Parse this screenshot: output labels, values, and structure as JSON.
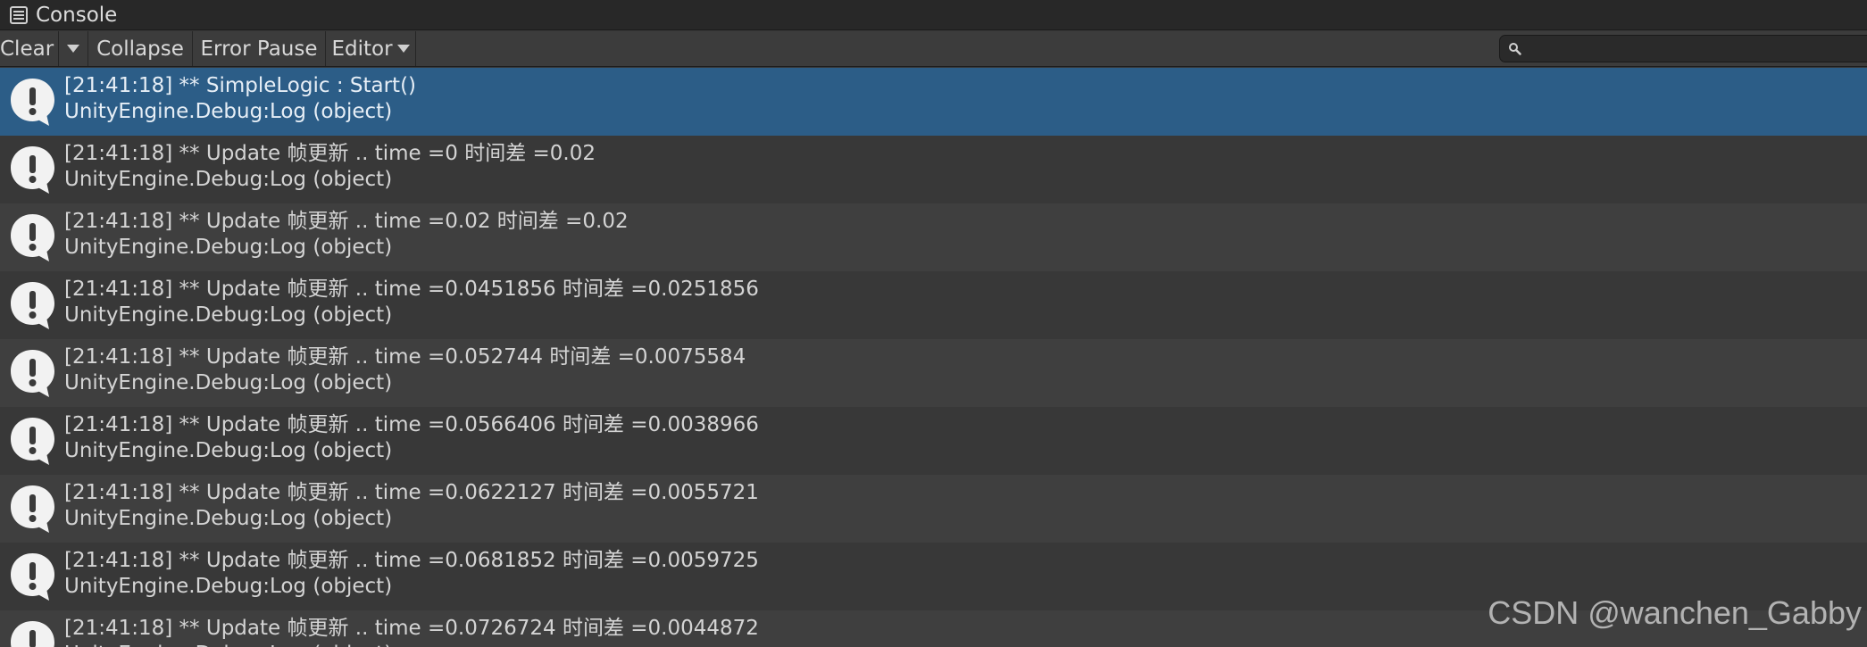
{
  "window": {
    "title": "Console",
    "tab_icon": "console-list-icon"
  },
  "toolbar": {
    "clear_label": "Clear",
    "clear_dropdown_icon": "chevron-down-icon",
    "collapse_label": "Collapse",
    "error_pause_label": "Error Pause",
    "editor_label": "Editor",
    "editor_dropdown_icon": "chevron-down-icon"
  },
  "search": {
    "icon": "search-icon",
    "value": "",
    "placeholder": ""
  },
  "log_entries": [
    {
      "message": "[21:41:18] ** SimpleLogic : Start()",
      "stack": "UnityEngine.Debug:Log (object)",
      "selected": true
    },
    {
      "message": "[21:41:18] ** Update 帧更新 .. time =0 时间差 =0.02",
      "stack": "UnityEngine.Debug:Log (object)"
    },
    {
      "message": "[21:41:18] ** Update 帧更新 .. time =0.02 时间差 =0.02",
      "stack": "UnityEngine.Debug:Log (object)"
    },
    {
      "message": "[21:41:18] ** Update 帧更新 .. time =0.0451856 时间差 =0.0251856",
      "stack": "UnityEngine.Debug:Log (object)"
    },
    {
      "message": "[21:41:18] ** Update 帧更新 .. time =0.052744 时间差 =0.0075584",
      "stack": "UnityEngine.Debug:Log (object)"
    },
    {
      "message": "[21:41:18] ** Update 帧更新 .. time =0.0566406 时间差 =0.0038966",
      "stack": "UnityEngine.Debug:Log (object)"
    },
    {
      "message": "[21:41:18] ** Update 帧更新 .. time =0.0622127 时间差 =0.0055721",
      "stack": "UnityEngine.Debug:Log (object)"
    },
    {
      "message": "[21:41:18] ** Update 帧更新 .. time =0.0681852 时间差 =0.0059725",
      "stack": "UnityEngine.Debug:Log (object)"
    },
    {
      "message": "[21:41:18] ** Update 帧更新 .. time =0.0726724 时间差 =0.0044872",
      "stack": "UnityEngine.Debug:Log (object)"
    }
  ],
  "log_icon": "info-message-icon",
  "watermark": "CSDN @wanchen_Gabby",
  "colors": {
    "selected_row": "#2c5d87",
    "row_bg": "#383838",
    "row_alt_bg": "#3f3f3f",
    "toolbar_bg": "#3c3c3c",
    "titlebar_bg": "#282828"
  }
}
